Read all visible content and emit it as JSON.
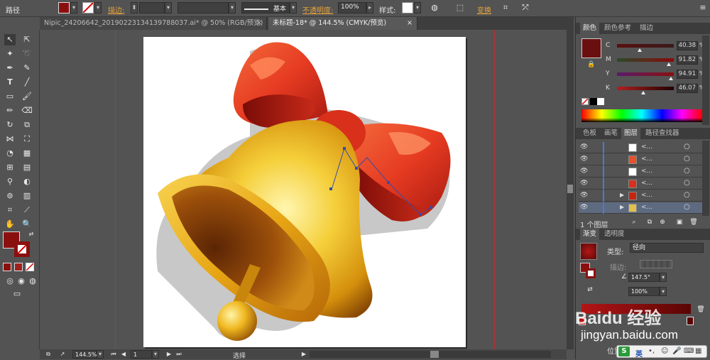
{
  "control_bar": {
    "path_label": "路径",
    "stroke_label": "描边:",
    "stroke_style": "基本",
    "opacity_label": "不透明度:",
    "opacity_value": "100%",
    "style_label": "样式:",
    "transform_label": "变换"
  },
  "tabs": [
    {
      "label": "Nipic_24206642_20190223134139788037.ai* @ 50% (RGB/预览)"
    },
    {
      "label": "未标题-18* @ 144.5% (CMYK/预览)"
    }
  ],
  "colors": {
    "fill": "#8a1010",
    "accent_link": "#e8a33a",
    "guide": "#c03030"
  },
  "color_panel": {
    "tabs": [
      "颜色",
      "颜色参考",
      "描边"
    ],
    "channels": [
      {
        "name": "C",
        "value": "40.38"
      },
      {
        "name": "M",
        "value": "91.82"
      },
      {
        "name": "Y",
        "value": "94.91"
      },
      {
        "name": "K",
        "value": "46.07"
      }
    ],
    "channel_levels_percent": [
      40.38,
      91.82,
      94.91,
      46.07
    ]
  },
  "layers_panel": {
    "tabs": [
      "色板",
      "画笔",
      "图层",
      "路径查找器"
    ],
    "rows": [
      {
        "name": "<..."
      },
      {
        "name": "<..."
      },
      {
        "name": "<..."
      },
      {
        "name": "<..."
      },
      {
        "name": "<..."
      },
      {
        "name": "<..."
      }
    ],
    "footer_label": "1 个图层"
  },
  "gradient_panel": {
    "tabs": [
      "渐变",
      "透明度"
    ],
    "type_label": "类型:",
    "type_value": "径向",
    "stroke_label": "描边:",
    "angle_value": "147.5°",
    "ratio_value": "100%",
    "location_label": "位置"
  },
  "status_bar": {
    "zoom": "144.5%",
    "artboard_number": "1",
    "tool_name": "选择"
  },
  "watermark": {
    "text": "Baidu 经验",
    "url": "jingyan.baidu.com"
  },
  "ime": {
    "mode": "英"
  }
}
